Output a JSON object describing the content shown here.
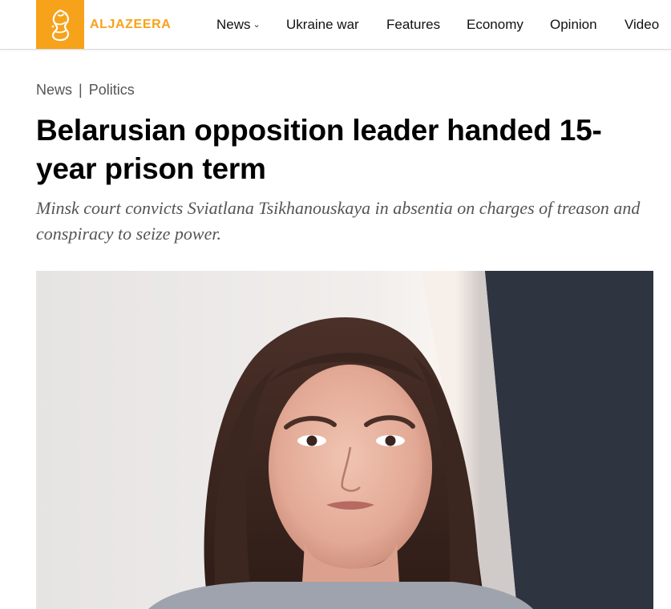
{
  "site": {
    "logo_text": "ALJAZEERA",
    "brand_color": "#f7a21b"
  },
  "nav": {
    "items": [
      {
        "label": "News",
        "has_dropdown": true
      },
      {
        "label": "Ukraine war"
      },
      {
        "label": "Features"
      },
      {
        "label": "Economy"
      },
      {
        "label": "Opinion"
      },
      {
        "label": "Video"
      }
    ],
    "dropdown_icon": "chevron-down-icon"
  },
  "breadcrumb": {
    "items": [
      "News",
      "Politics"
    ],
    "separator": "|"
  },
  "article": {
    "headline": "Belarusian opposition leader handed 15-year prison term",
    "subhead": "Minsk court convicts Sviatlana Tsikhanouskaya in absentia on charges of treason and conspiracy to seize power.",
    "hero_image": "photo-of-woman-portrait"
  }
}
